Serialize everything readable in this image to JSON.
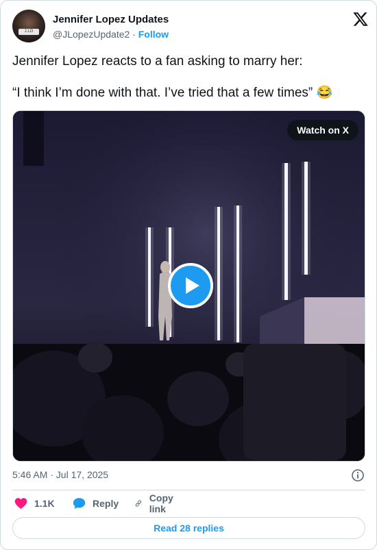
{
  "author": {
    "name": "Jennifer Lopez Updates",
    "handle": "@JLopezUpdate2",
    "separator": " · ",
    "follow_label": "Follow",
    "avatar_badge": "J.LO"
  },
  "tweet": {
    "line1": "Jennifer Lopez reacts to a fan asking to marry her:",
    "line2": "“I think I’m done with that. I’ve tried that a few times” 😂"
  },
  "media": {
    "watch_label": "Watch on X"
  },
  "meta": {
    "timestamp": "5:46 AM · Jul 17, 2025"
  },
  "actions": {
    "likes": "1.1K",
    "reply_label": "Reply",
    "copy_label": "Copy link"
  },
  "read_replies_label": "Read 28 replies",
  "colors": {
    "accent": "#1d9bf0",
    "like": "#f91880",
    "text": "#0f1419",
    "muted": "#536471",
    "border": "#cfd9de"
  },
  "icons": [
    "x-logo-icon",
    "play-icon",
    "info-icon",
    "heart-icon",
    "reply-bubble-icon",
    "link-icon"
  ]
}
